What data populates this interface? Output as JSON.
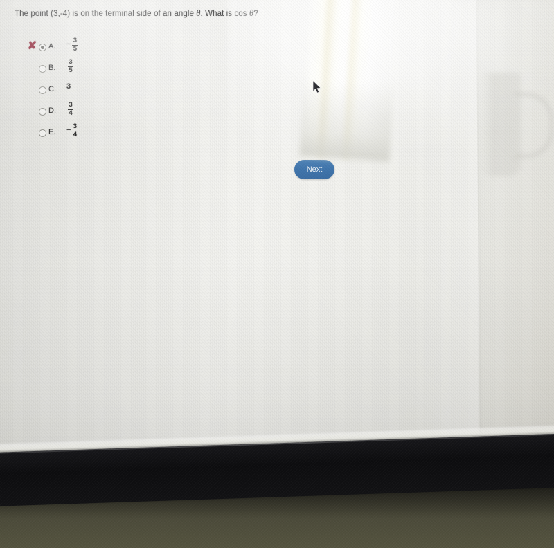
{
  "photo": {
    "scene": "photograph of a computer monitor showing an online math quiz",
    "screen_bg": "#e2e2db",
    "bezel_color": "#111113",
    "desk_color": "#4a4939"
  },
  "quiz": {
    "question": "The point (3,-4) is on the terminal side of an angle ",
    "question_theta_1": "θ",
    "question_mid": ". What is cos ",
    "question_theta_2": "θ",
    "question_end": "?",
    "options": [
      {
        "letter": "A.",
        "value_display": "-3/5",
        "negative": "−",
        "numerator": "3",
        "denominator": "5",
        "is_fraction": true,
        "selected": true,
        "marked_incorrect": true,
        "mark_glyph": "✘"
      },
      {
        "letter": "B.",
        "value_display": "3/5",
        "negative": "",
        "numerator": "3",
        "denominator": "5",
        "is_fraction": true,
        "selected": false,
        "marked_incorrect": false,
        "mark_glyph": ""
      },
      {
        "letter": "C.",
        "value_display": "3",
        "negative": "",
        "whole": "3",
        "is_fraction": false,
        "selected": false,
        "marked_incorrect": false,
        "mark_glyph": ""
      },
      {
        "letter": "D.",
        "value_display": "3/4",
        "negative": "",
        "numerator": "3",
        "denominator": "4",
        "is_fraction": true,
        "selected": false,
        "marked_incorrect": false,
        "mark_glyph": ""
      },
      {
        "letter": "E.",
        "value_display": "-3/4",
        "negative": "−",
        "numerator": "3",
        "denominator": "4",
        "is_fraction": true,
        "selected": false,
        "marked_incorrect": false,
        "mark_glyph": ""
      }
    ],
    "next_button_label": "Next",
    "next_button_color": "#3f74ab",
    "incorrect_mark_color": "#8a1c2e"
  },
  "overlays": {
    "cursor": "mouse-pointer",
    "glare": "window-light-reflection",
    "mug_reflection": "coffee-mug-silhouette"
  }
}
